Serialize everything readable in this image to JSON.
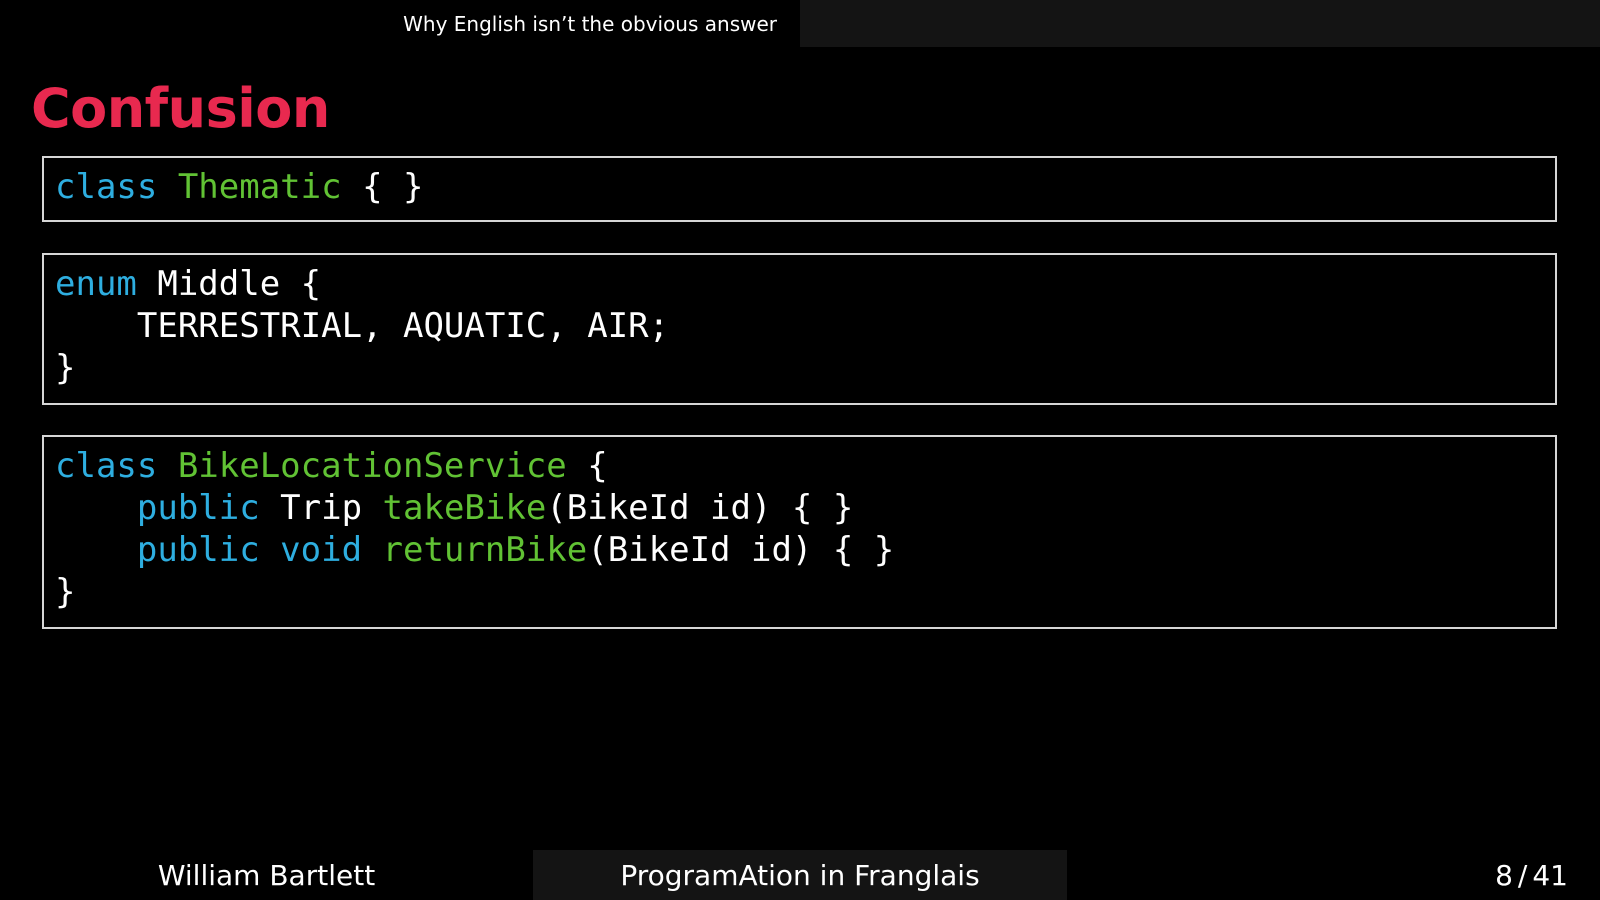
{
  "header": {
    "section_title": "Why English isn’t the obvious answer"
  },
  "slide": {
    "title": "Confusion"
  },
  "code_blocks": [
    {
      "lines": [
        [
          {
            "text": "class ",
            "role": "keyword"
          },
          {
            "text": "Thematic",
            "role": "type"
          },
          {
            "text": " { }",
            "role": "plain"
          }
        ]
      ]
    },
    {
      "lines": [
        [
          {
            "text": "enum ",
            "role": "keyword"
          },
          {
            "text": "Middle {",
            "role": "plain"
          }
        ],
        [
          {
            "text": "    TERRESTRIAL, AQUATIC, AIR;",
            "role": "plain"
          }
        ],
        [
          {
            "text": "}",
            "role": "plain"
          }
        ]
      ]
    },
    {
      "lines": [
        [
          {
            "text": "class ",
            "role": "keyword"
          },
          {
            "text": "BikeLocationService",
            "role": "type"
          },
          {
            "text": " {",
            "role": "plain"
          }
        ],
        [
          {
            "text": "    public ",
            "role": "keyword"
          },
          {
            "text": "Trip ",
            "role": "plain"
          },
          {
            "text": "takeBike",
            "role": "function"
          },
          {
            "text": "(BikeId id) { }",
            "role": "plain"
          }
        ],
        [
          {
            "text": "    public void ",
            "role": "keyword"
          },
          {
            "text": "returnBike",
            "role": "function"
          },
          {
            "text": "(BikeId id) { }",
            "role": "plain"
          }
        ],
        [
          {
            "text": "}",
            "role": "plain"
          }
        ]
      ]
    }
  ],
  "footer": {
    "author": "William Bartlett",
    "talk_title": "ProgramAtion in Franglais",
    "page_current": "8",
    "page_separator": "/",
    "page_total": "41"
  },
  "colors": {
    "title": "#e8294f",
    "keyword": "#2eaee0",
    "type": "#61c234",
    "function": "#61c234",
    "plain": "#ffffff",
    "background": "#000000",
    "bar": "#141414"
  }
}
